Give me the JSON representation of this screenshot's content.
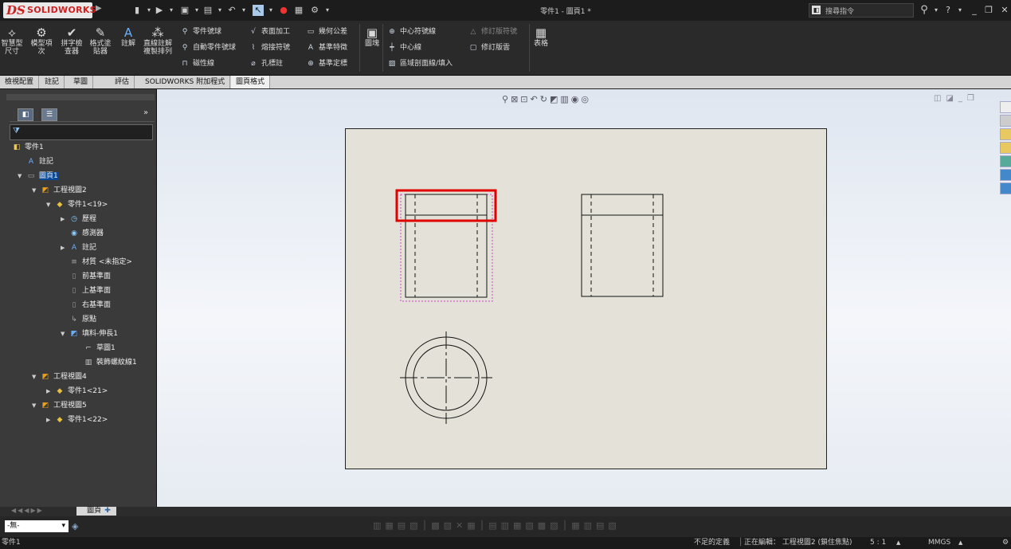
{
  "titlebar": {
    "brand_ds": "DS",
    "brand_name": "SOLIDWORKS",
    "doc_title": "零件1 - 圖頁1 *",
    "search_placeholder": "搜尋指令",
    "icons": [
      "new-icon",
      "open-icon",
      "save-icon",
      "print-icon",
      "undo-icon",
      "select-icon",
      "rebuild-icon",
      "file-properties-icon",
      "options-icon"
    ]
  },
  "ribbon": {
    "smart_dim": "智慧型\n尺寸",
    "model_items": "模型項\n次",
    "spell": "拼字檢\n查器",
    "format_painter": "格式塗\n貼器",
    "note": "註解",
    "linear_note": "直線註解\n複製排列",
    "balloon": "零件號球",
    "auto_balloon": "自動零件號球",
    "magnetic_line": "磁性線",
    "surface_finish": "表面加工",
    "weld_symbol": "熔接符號",
    "hole_callout": "孔標註",
    "geo_tolerance": "幾何公差",
    "datum_feature": "基準特徵",
    "datum_target": "基準定標",
    "blocks": "圖塊",
    "center_mark": "中心符號線",
    "centerline": "中心線",
    "area_hatch": "區域剖面線/填入",
    "revision_symbol": "修訂版符號",
    "revision_cloud": "修訂版雲",
    "tables": "表格"
  },
  "tabs": [
    "檢視配置",
    "註記",
    "草圖",
    "評估",
    "SOLIDWORKS 附加程式",
    "圖頁格式"
  ],
  "active_tab": "圖頁格式",
  "tree": {
    "items": [
      {
        "label": "零件1",
        "level": 0,
        "icon": "drawing-icon"
      },
      {
        "label": "註記",
        "level": 1,
        "icon": "annotation-icon"
      },
      {
        "label": "圖頁1",
        "level": 1,
        "icon": "sheet-icon",
        "selected": true
      },
      {
        "label": "工程視圖2",
        "level": 2,
        "icon": "drawing-view-icon"
      },
      {
        "label": "零件1<19>",
        "level": 3,
        "icon": "part-icon"
      },
      {
        "label": "歷程",
        "level": 4,
        "icon": "history-icon"
      },
      {
        "label": "感測器",
        "level": 4,
        "icon": "sensor-icon"
      },
      {
        "label": "註記",
        "level": 4,
        "icon": "annotation-icon"
      },
      {
        "label": "材質 <未指定>",
        "level": 4,
        "icon": "material-icon"
      },
      {
        "label": "前基準面",
        "level": 4,
        "icon": "plane-icon"
      },
      {
        "label": "上基準面",
        "level": 4,
        "icon": "plane-icon"
      },
      {
        "label": "右基準面",
        "level": 4,
        "icon": "plane-icon"
      },
      {
        "label": "原點",
        "level": 4,
        "icon": "origin-icon"
      },
      {
        "label": "填料-伸長1",
        "level": 4,
        "icon": "extrude-icon"
      },
      {
        "label": "草圖1",
        "level": 5,
        "icon": "sketch-icon"
      },
      {
        "label": "裝飾螺紋線1",
        "level": 5,
        "icon": "cosmetic-thread-icon"
      },
      {
        "label": "工程視圖4",
        "level": 2,
        "icon": "drawing-view-icon"
      },
      {
        "label": "零件1<21>",
        "level": 3,
        "icon": "part-icon"
      },
      {
        "label": "工程視圖5",
        "level": 2,
        "icon": "drawing-view-icon"
      },
      {
        "label": "零件1<22>",
        "level": 3,
        "icon": "part-icon"
      }
    ]
  },
  "bottom": {
    "sheet_tab": "圖頁1",
    "layer_value": "-無-"
  },
  "status": {
    "left": "零件1",
    "underdefined": "不足的定義",
    "editing": "正在編輯： 工程視圖2 (鎖住焦點)",
    "scale": "5 : 1",
    "units": "MMGS"
  },
  "colors": {
    "sheet_bg": "#e4e2d8",
    "highlight_box": "#e00000",
    "selection_dotted": "#d040d0",
    "tree_selected": "#0a4a9a"
  }
}
